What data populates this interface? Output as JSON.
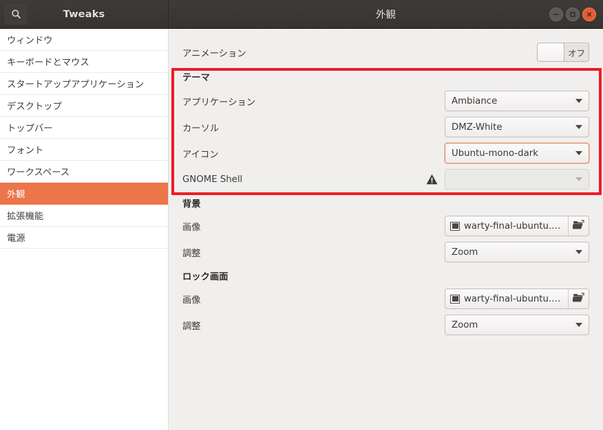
{
  "header": {
    "app_title": "Tweaks",
    "page_title": "外観",
    "search_icon": "search-icon",
    "window_buttons": {
      "minimize": "minimize-icon",
      "maximize": "maximize-icon",
      "close": "close-icon"
    }
  },
  "colors": {
    "accent": "#ec754a",
    "headerbar": "#3b3734",
    "close_button": "#e35d30",
    "annotation": "#ec1c24",
    "panel_bg": "#f1efee",
    "sidebar_bg": "#ffffff"
  },
  "sidebar": {
    "items": [
      {
        "label": "ウィンドウ",
        "selected": false
      },
      {
        "label": "キーボードとマウス",
        "selected": false
      },
      {
        "label": "スタートアップアプリケーション",
        "selected": false
      },
      {
        "label": "デスクトップ",
        "selected": false
      },
      {
        "label": "トップバー",
        "selected": false
      },
      {
        "label": "フォント",
        "selected": false
      },
      {
        "label": "ワークスペース",
        "selected": false
      },
      {
        "label": "外観",
        "selected": true
      },
      {
        "label": "拡張機能",
        "selected": false
      },
      {
        "label": "電源",
        "selected": false
      }
    ]
  },
  "main": {
    "animation": {
      "label": "アニメーション",
      "toggle_state": "オフ"
    },
    "theme": {
      "heading": "テーマ",
      "application": {
        "label": "アプリケーション",
        "value": "Ambiance"
      },
      "cursor": {
        "label": "カーソル",
        "value": "DMZ-White"
      },
      "icons": {
        "label": "アイコン",
        "value": "Ubuntu-mono-dark",
        "focused": true
      },
      "gnome_shell": {
        "label": "GNOME Shell",
        "value": "",
        "warning_icon": "warning-triangle-icon",
        "disabled": true
      }
    },
    "background": {
      "heading": "背景",
      "image": {
        "label": "画像",
        "value": "warty-final-ubuntu.png",
        "thumb_icon": "image-thumbnail-icon",
        "open_icon": "open-folder-icon"
      },
      "adjustment": {
        "label": "調整",
        "value": "Zoom"
      }
    },
    "lock_screen": {
      "heading": "ロック画面",
      "image": {
        "label": "画像",
        "value": "warty-final-ubuntu.png",
        "thumb_icon": "image-thumbnail-icon",
        "open_icon": "open-folder-icon"
      },
      "adjustment": {
        "label": "調整",
        "value": "Zoom"
      }
    }
  },
  "annotation": {
    "highlight_region": "theme-section"
  }
}
